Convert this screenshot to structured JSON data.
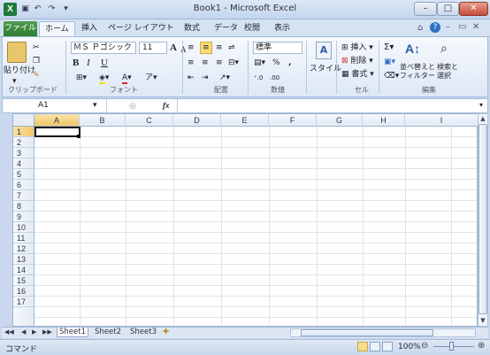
{
  "window": {
    "title": "Book1 - Microsoft Excel"
  },
  "quick_access": {
    "undo": "↶",
    "redo": "↷",
    "customize": "▾"
  },
  "tabs": [
    "ファイル",
    "ホーム",
    "挿入",
    "ページ レイアウト",
    "数式",
    "データ",
    "校閲",
    "表示"
  ],
  "ribbon": {
    "clipboard": {
      "paste": "貼り付け",
      "label": "クリップボード"
    },
    "font": {
      "name": "ＭＳ Ｐゴシック",
      "size": "11",
      "bold": "B",
      "italic": "I",
      "underline": "U",
      "grow": "A",
      "shrink": "A",
      "label": "フォント"
    },
    "alignment": {
      "label": "配置"
    },
    "number": {
      "format": "標準",
      "percent": "%",
      "comma": ",",
      "label": "数値"
    },
    "styles": {
      "style": "スタイル"
    },
    "cells": {
      "insert": "挿入",
      "delete": "削除",
      "format": "書式",
      "label": "セル"
    },
    "editing": {
      "sum": "Σ",
      "sort": "並べ替えと",
      "sort2": "フィルター",
      "find": "検索と",
      "find2": "選択",
      "label": "編集"
    }
  },
  "formula_bar": {
    "name_box": "A1",
    "fx": "fx",
    "content": ""
  },
  "columns": [
    "A",
    "B",
    "C",
    "D",
    "E",
    "F",
    "G",
    "H",
    "I"
  ],
  "rows": [
    "1",
    "2",
    "3",
    "4",
    "5",
    "6",
    "7",
    "8",
    "9",
    "10",
    "11",
    "12",
    "13",
    "14",
    "15",
    "16",
    "17"
  ],
  "sheets": [
    "Sheet1",
    "Sheet2",
    "Sheet3"
  ],
  "status": {
    "mode": "コマンド",
    "zoom": "100%"
  }
}
